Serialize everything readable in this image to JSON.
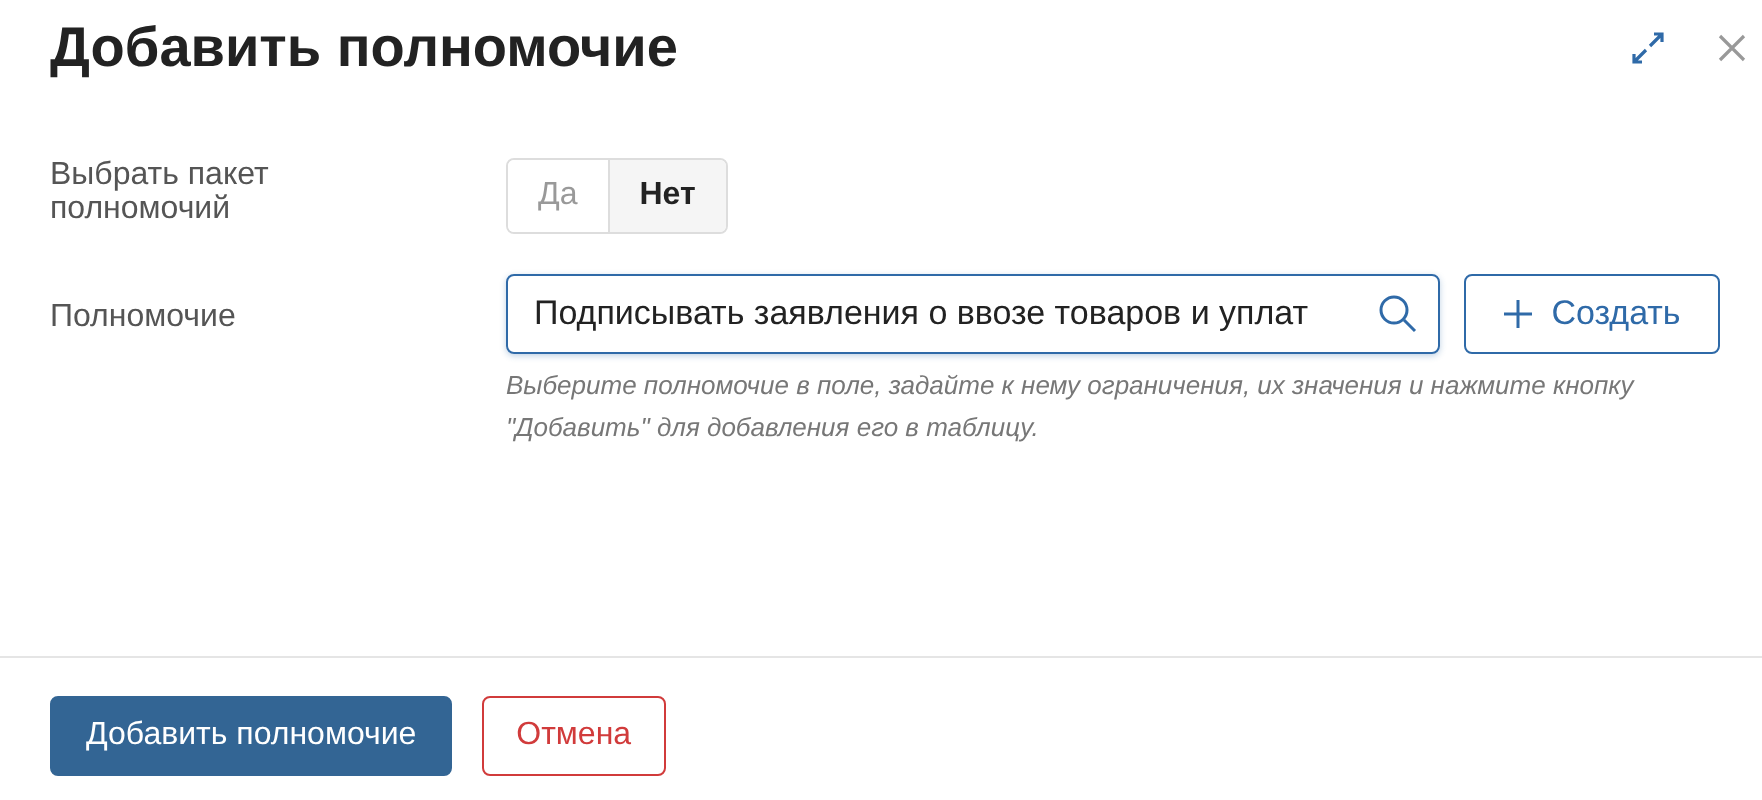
{
  "dialog": {
    "title": "Добавить полномочие"
  },
  "package_field": {
    "label": "Выбрать пакет полномочий",
    "options": [
      {
        "label": "Да",
        "selected": false
      },
      {
        "label": "Нет",
        "selected": true
      }
    ]
  },
  "permission_field": {
    "label": "Полномочие",
    "value": "Подписывать заявления о ввозе товаров и уплат",
    "create_button": "Создать",
    "hint": "Выберите полномочие в поле, задайте к нему ограничения, их значения и нажмите кнопку \"Добавить\" для добавления его в таблицу."
  },
  "footer": {
    "buttons": [
      {
        "label": "Добавить полномочие",
        "kind": "primary"
      },
      {
        "label": "Отмена",
        "kind": "cancel"
      }
    ]
  }
}
